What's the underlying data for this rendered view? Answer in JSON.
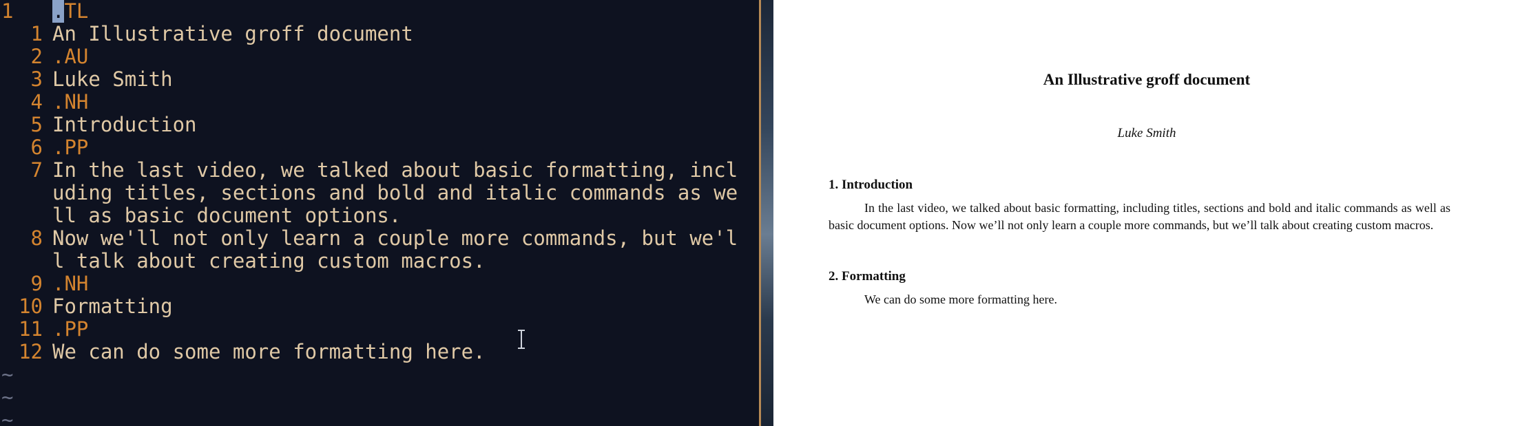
{
  "editor": {
    "lines": [
      {
        "num": "1",
        "text": ".TL",
        "kind": "macro",
        "current": true
      },
      {
        "num": "1",
        "text": "An Illustrative groff document",
        "kind": "text"
      },
      {
        "num": "2",
        "text": ".AU",
        "kind": "macro"
      },
      {
        "num": "3",
        "text": "Luke Smith",
        "kind": "text"
      },
      {
        "num": "4",
        "text": ".NH",
        "kind": "macro"
      },
      {
        "num": "5",
        "text": "Introduction",
        "kind": "text"
      },
      {
        "num": "6",
        "text": ".PP",
        "kind": "macro"
      },
      {
        "num": "7",
        "text": "In the last video, we talked about basic formatting, incl",
        "kind": "text"
      },
      {
        "num": "",
        "text": "uding titles, sections and bold and italic commands as we",
        "kind": "text"
      },
      {
        "num": "",
        "text": "ll as basic document options.",
        "kind": "text"
      },
      {
        "num": "8",
        "text": "Now we'll not only learn a couple more commands, but we'l",
        "kind": "text"
      },
      {
        "num": "",
        "text": "l talk about creating custom macros.",
        "kind": "text"
      },
      {
        "num": "9",
        "text": ".NH",
        "kind": "macro"
      },
      {
        "num": "10",
        "text": "Formatting",
        "kind": "text"
      },
      {
        "num": "11",
        "text": ".PP",
        "kind": "macro"
      },
      {
        "num": "12",
        "text": "We can do some more formatting here.",
        "kind": "text"
      }
    ],
    "empty_marker": "~",
    "empty_lines": 3
  },
  "document": {
    "title": "An Illustrative groff document",
    "author": "Luke Smith",
    "sections": [
      {
        "heading": "1.  Introduction",
        "paragraph": "In the last video, we talked about basic formatting, including titles, sections and bold and italic commands as well as basic document options.  Now we’ll not only learn a couple more commands, but we’ll talk about creating custom macros."
      },
      {
        "heading": "2.  Formatting",
        "paragraph": "We can do some more formatting here."
      }
    ]
  },
  "colors": {
    "editor_bg": "#0e1220",
    "line_number": "#d4842f",
    "macro": "#d4842f",
    "text": "#e0c9a6",
    "tilde": "#6c7288",
    "cursor": "#8aa2c8",
    "document_bg": "#ffffff"
  },
  "icons": {
    "text_cursor": "i-beam-icon"
  }
}
